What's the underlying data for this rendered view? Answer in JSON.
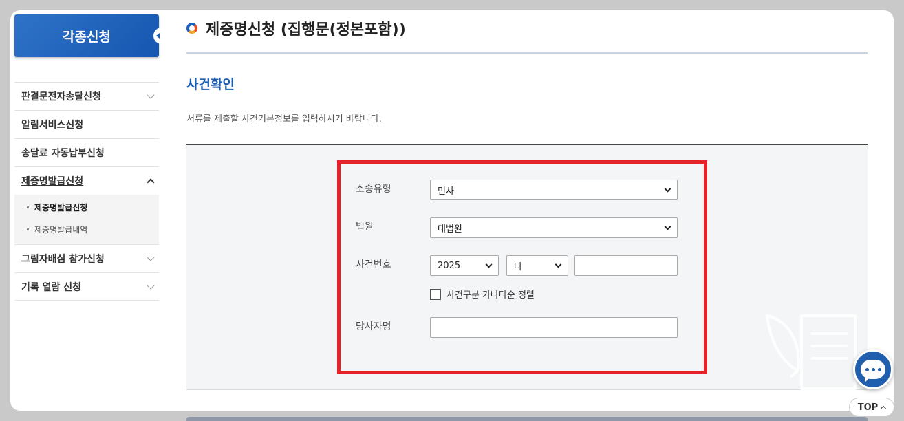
{
  "sidebar": {
    "header": "각종신청",
    "items": [
      {
        "label": "판결문전자송달신청"
      },
      {
        "label": "알림서비스신청"
      },
      {
        "label": "송달료 자동납부신청"
      },
      {
        "label": "제증명발급신청"
      },
      {
        "label": "그림자배심 참가신청"
      },
      {
        "label": "기록 열람 신청"
      }
    ],
    "submenu": [
      {
        "label": "제증명발급신청"
      },
      {
        "label": "제증명발급내역"
      }
    ]
  },
  "main": {
    "title": "제증명신청 (집행문(정본포함))",
    "section_heading": "사건확인",
    "description": "서류를 제출할 사건기본정보를 입력하시기 바랍니다."
  },
  "form": {
    "case_type_label": "소송유형",
    "case_type_value": "민사",
    "court_label": "법원",
    "court_value": "대법원",
    "case_number_label": "사건번호",
    "year_value": "2025",
    "case_code_value": "다",
    "case_number_value": "",
    "sort_checkbox_label": "사건구분 가나다순 정렬",
    "sort_checked": false,
    "party_name_label": "당사자명",
    "party_name_value": ""
  },
  "ui": {
    "top_button": "TOP",
    "chat_icon": "chat-icon",
    "highlight_color": "#e52129",
    "accent_color": "#1c5db4"
  }
}
